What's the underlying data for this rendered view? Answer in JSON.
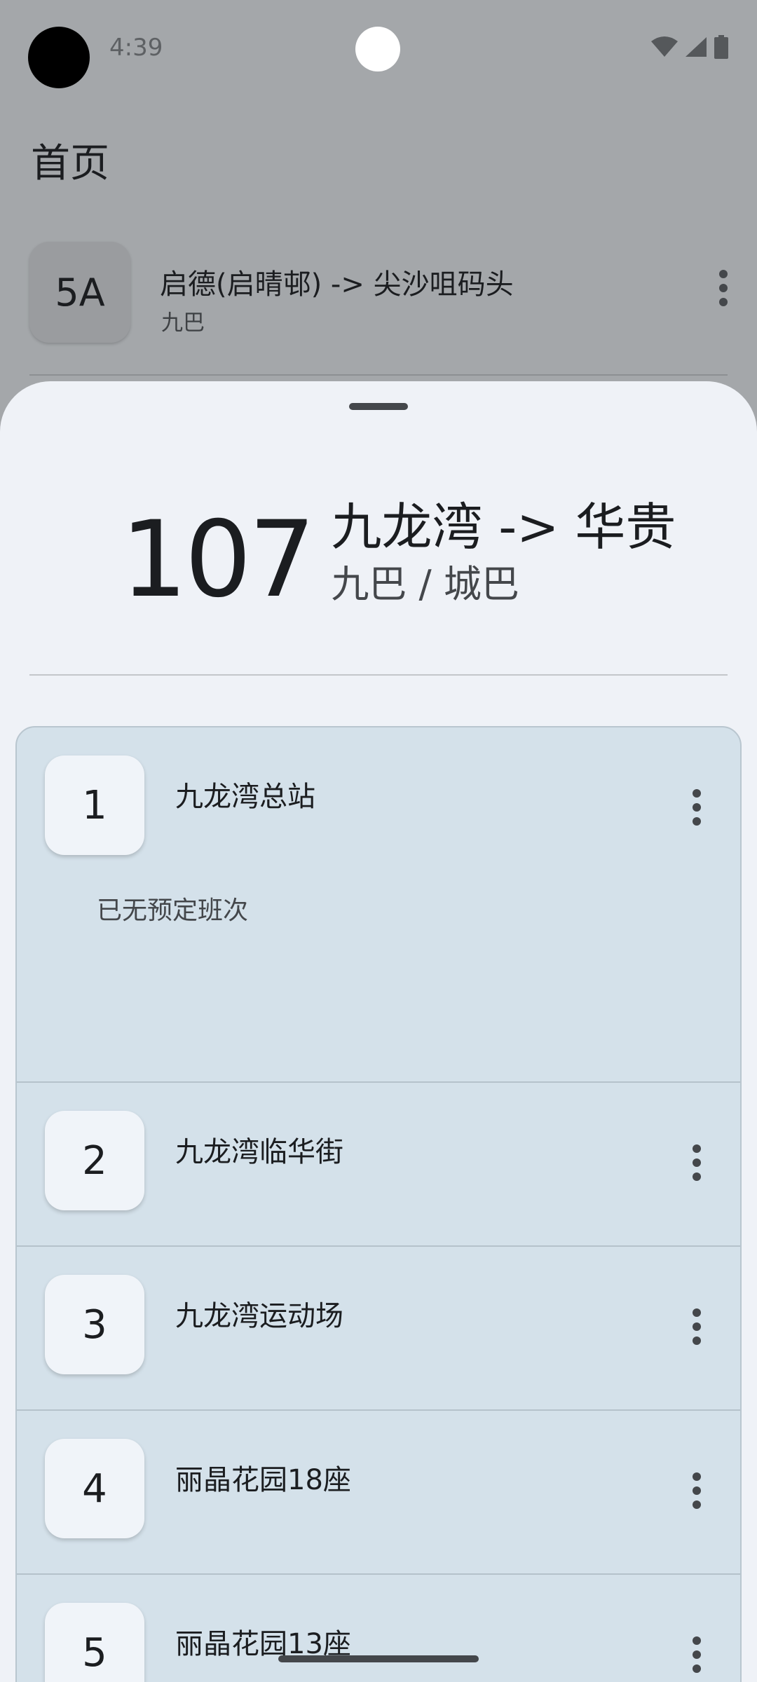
{
  "status_bar": {
    "time": "4:39",
    "icons": [
      "wifi-icon",
      "signal-icon",
      "battery-icon"
    ]
  },
  "home": {
    "title": "首页",
    "routes": [
      {
        "number": "5A",
        "title": "启德(启晴邨) -> 尖沙咀码头",
        "operator": "九巴"
      }
    ]
  },
  "sheet": {
    "route_number": "107",
    "direction": "九龙湾 -> 华贵",
    "companies": "九巴 / 城巴",
    "stops": [
      {
        "seq": "1",
        "name": "九龙湾总站",
        "eta": "已无预定班次"
      },
      {
        "seq": "2",
        "name": "九龙湾临华街"
      },
      {
        "seq": "3",
        "name": "九龙湾运动场"
      },
      {
        "seq": "4",
        "name": "丽晶花园18座"
      },
      {
        "seq": "5",
        "name": "丽晶花园13座"
      }
    ]
  },
  "colors": {
    "scrim_background": "#a4a7aa",
    "sheet_background": "#eff2f7",
    "stop_card_background": "#d4e1ea",
    "badge_background": "#f0f4f9",
    "text_primary": "#1b1d20",
    "text_secondary": "#44474b"
  }
}
